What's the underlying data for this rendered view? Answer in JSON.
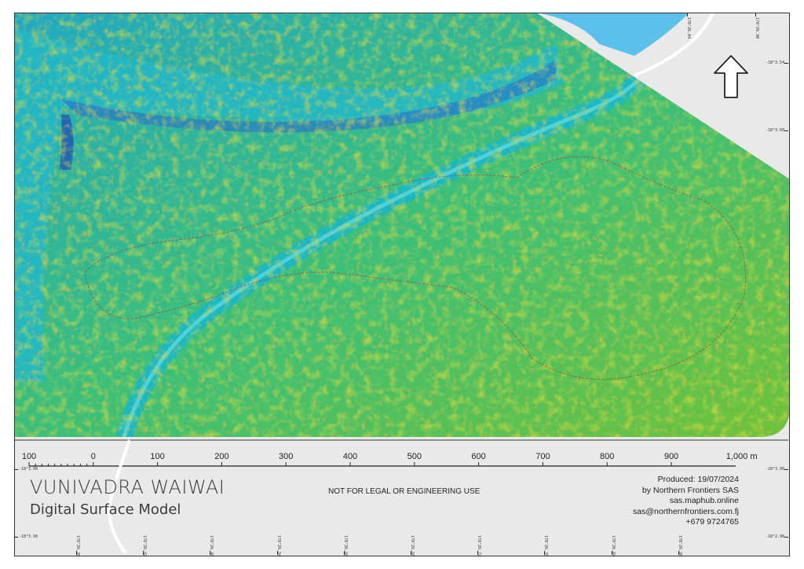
{
  "map": {
    "title": "VUNIVADRA WAIWAI",
    "subtitle": "Digital Surface Model",
    "disclaimer": "NOT FOR LEGAL OR ENGINEERING USE",
    "credits": {
      "produced": "Produced: 19/07/2024",
      "by": "by Northern Frontiers SAS",
      "website": "sas.maphub.online",
      "email": "sas@northernfrontiers.com.fj",
      "phone": "+679 9724765"
    },
    "north_arrow_icon": "north-arrow-icon",
    "colors": {
      "low": "#1a3fb5",
      "mid_low": "#18b4c9",
      "mid": "#3cb84a",
      "mid_high": "#c9c21c",
      "high": "#d2691e",
      "water": "#5bc0eb",
      "boundary": "#b03030"
    }
  },
  "scale_bar": {
    "labels": [
      "100",
      "0",
      "100",
      "200",
      "300",
      "400",
      "500",
      "600",
      "700",
      "800",
      "900"
    ],
    "end_label": "1,000 m"
  },
  "graticule": {
    "top": [
      "178°26.84",
      "178°26.90"
    ],
    "bottom": [
      "178°26.36",
      "178°26.42",
      "178°26.48",
      "178°26.54",
      "178°26.60",
      "178°26.66",
      "178°26.72",
      "178°26.78",
      "178°26.84",
      "178°26.90"
    ],
    "left": [
      "-18°3.90",
      "-18°3.96"
    ],
    "right": [
      "-18°3.54",
      "-18°3.60",
      "-18°3.90",
      "-18°2.96"
    ]
  }
}
